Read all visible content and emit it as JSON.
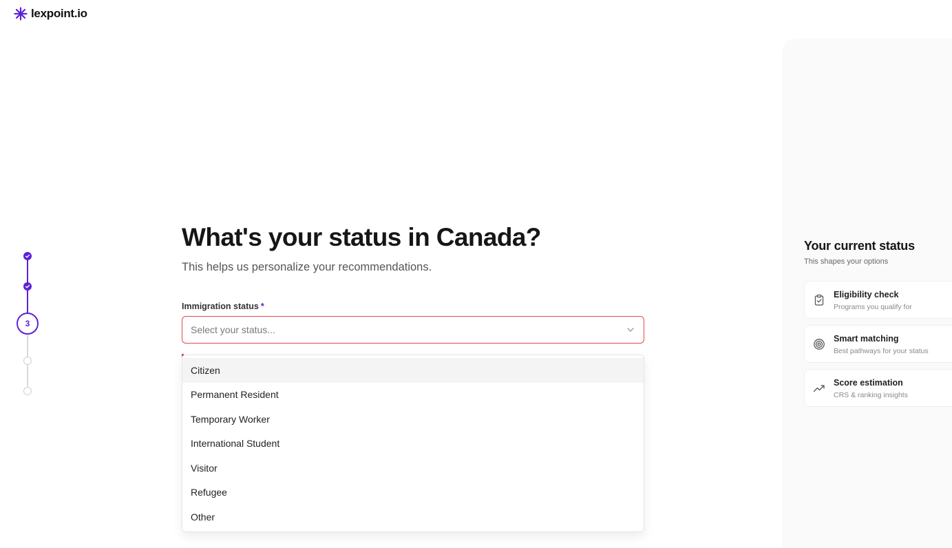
{
  "brand": {
    "name": "lexpoint.io",
    "accent": "#5b21d9"
  },
  "stepper": {
    "steps": [
      {
        "state": "done"
      },
      {
        "state": "done"
      },
      {
        "state": "current",
        "label": "3"
      },
      {
        "state": "todo"
      },
      {
        "state": "todo"
      }
    ]
  },
  "main": {
    "title": "What's your status in Canada?",
    "subtitle": "This helps us personalize your recommendations.",
    "field_label": "Immigration status",
    "required_mark": "*",
    "select_placeholder": "Select your status...",
    "options": [
      "Citizen",
      "Permanent Resident",
      "Temporary Worker",
      "International Student",
      "Visitor",
      "Refugee",
      "Other"
    ],
    "highlighted_option": "Citizen",
    "error_color": "#e04a4a"
  },
  "panel": {
    "title": "Your current status",
    "subtitle": "This shapes your options",
    "cards": [
      {
        "icon": "clipboard-check-icon",
        "title": "Eligibility check",
        "desc": "Programs you qualify for"
      },
      {
        "icon": "target-icon",
        "title": "Smart matching",
        "desc": "Best pathways for your status"
      },
      {
        "icon": "trending-up-icon",
        "title": "Score estimation",
        "desc": "CRS & ranking insights"
      }
    ]
  }
}
